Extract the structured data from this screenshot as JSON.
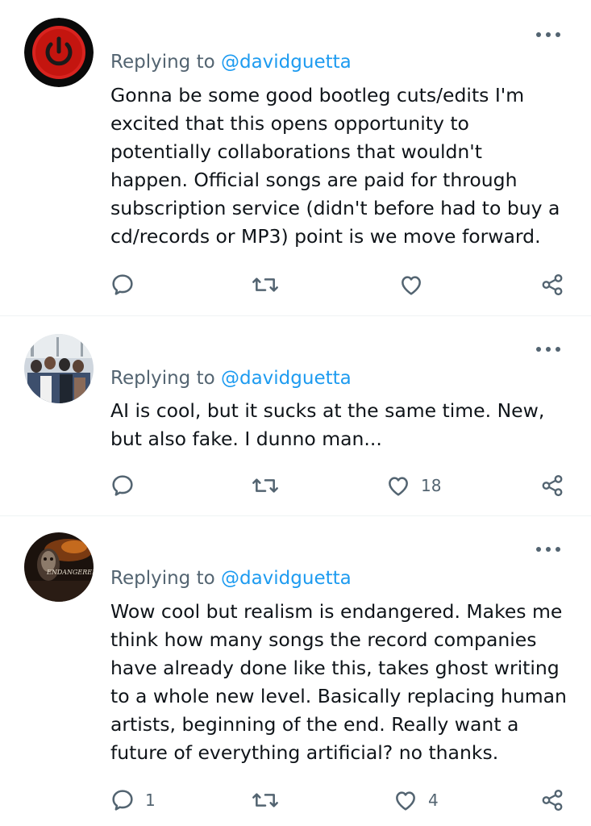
{
  "replies": [
    {
      "replying_prefix": "Replying to",
      "handle": "@davidguetta",
      "lines": [
        "Gonna be some good bootleg cuts/edits I'm",
        "excited that this opens opportunity to",
        "potentially collaborations that wouldn't",
        "happen. Official songs are paid for through",
        "subscription service (didn't before had to buy a",
        "cd/records or MP3) point is we move forward."
      ],
      "reply_count": "",
      "retweet_count": "",
      "like_count": "",
      "avatar_icon": "power-button-icon"
    },
    {
      "replying_prefix": "Replying to",
      "handle": "@davidguetta",
      "lines": [
        "AI is cool, but it sucks at the same time. New,",
        "but also fake. I dunno man..."
      ],
      "reply_count": "",
      "retweet_count": "",
      "like_count": "18",
      "avatar_icon": "group-photo-avatar"
    },
    {
      "replying_prefix": "Replying to",
      "handle": "@davidguetta",
      "avatar_text": "ENDANGERED",
      "lines": [
        "Wow cool but realism is endangered. Makes me",
        "think how many songs the record companies",
        "have already done like this, takes ghost writing",
        "to a whole new level. Basically replacing human",
        "artists, beginning of the end. Really want a",
        "future of everything artificial? no thanks."
      ],
      "reply_count": "1",
      "retweet_count": "",
      "like_count": "4",
      "avatar_icon": "album-art-avatar"
    }
  ],
  "colors": {
    "text": "#0f1419",
    "secondary": "#536471",
    "link": "#1d9bf0",
    "divider": "#eff3f4"
  }
}
